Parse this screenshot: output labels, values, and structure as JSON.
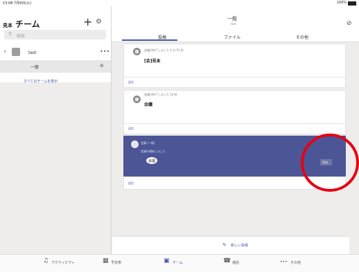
{
  "status": {
    "time": "13:08  7月8日(火)",
    "battery": "100%"
  },
  "sidebar": {
    "header_sub": "見本",
    "header_title": "チーム",
    "plus_glyph": "+",
    "search_placeholder": "検索",
    "team": {
      "name": "test",
      "more": "•••"
    },
    "channel": {
      "name": "一般"
    },
    "show_all": "すべてのチームを表示"
  },
  "channel_header": {
    "title": "一般",
    "subtitle": "test"
  },
  "tabs": [
    {
      "label": "投稿"
    },
    {
      "label": "ファイル"
    },
    {
      "label": "その他"
    }
  ],
  "posts": [
    {
      "meta": "会議が終了しました 4 分 51 秒",
      "title": "[会]見本",
      "reply": "返信"
    },
    {
      "meta": "会議が終了しました 10 秒",
      "title": "会議",
      "reply": "返信"
    },
    {
      "meta": "会議 (一般)",
      "subtitle": "会議を開始しました",
      "chip": "会議",
      "join": "参加",
      "reply": "返信"
    }
  ],
  "compose": {
    "label": "新しい投稿"
  },
  "bottom_nav": [
    {
      "label": "アクティビティ",
      "icon": "bell-icon"
    },
    {
      "label": "予定表",
      "icon": "calendar-icon"
    },
    {
      "label": "チーム",
      "icon": "teams-icon"
    },
    {
      "label": "通話",
      "icon": "phone-icon"
    },
    {
      "label": "その他",
      "icon": "more-icon"
    }
  ],
  "colors": {
    "accent": "#4a57a5",
    "highlight": "#4c5696",
    "annotation": "#e60012"
  }
}
